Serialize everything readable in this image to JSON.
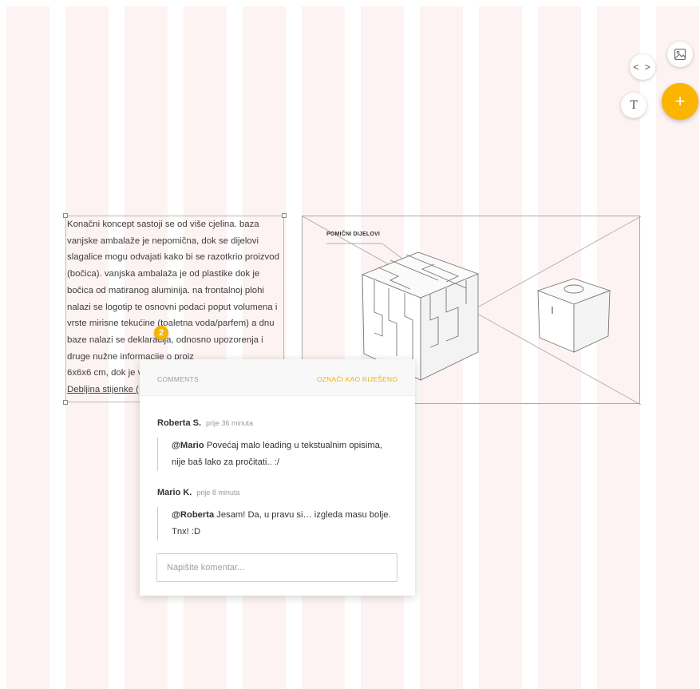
{
  "text_block": {
    "paragraph": "Konačni koncept sastoji se od više cjelina. baza vanjske ambalaže je nepomična, dok se dijelovi slagalice mogu odvajati kako bi se razotkrio proizvod (bočica). vanjska ambalaža je od plastike dok je bočica od matiranog aluminija. na frontalnoj plohi nalazi se logotip te osnovni podaci poput volumena i vrste mirisne tekućine (toaletna voda/parfem) a dnu baze nalazi se deklaracija, odnosno upozorenja i druge nužne informacije o proiz",
    "line_tail": "6x6x6 cm, dok je v",
    "line_last": "Debljina stijenke ("
  },
  "image": {
    "label": "POMIČNI DIJELOVI"
  },
  "comment_marker": {
    "count": "2"
  },
  "comments_panel": {
    "title": "COMMENTS",
    "resolve_label": "OZNAČI KAO RIJEŠENO",
    "comments": [
      {
        "author": "Roberta S.",
        "time": "prije 36 minuta",
        "mention": "@Mario",
        "text": " Povećaj malo leading u tekstualnim opisima, nije baš lako za pročitati.. :/"
      },
      {
        "author": "Mario K.",
        "time": "prije 8 minuta",
        "mention": "@Roberta",
        "text": " Jesam! Da, u pravu si… izgleda masu bolje. Tnx! :D"
      }
    ],
    "input_placeholder": "Napišite komentar..."
  },
  "toolbar": {
    "code_label": "< >",
    "text_label": "T",
    "add_label": "+",
    "accent": "#fbb400"
  }
}
